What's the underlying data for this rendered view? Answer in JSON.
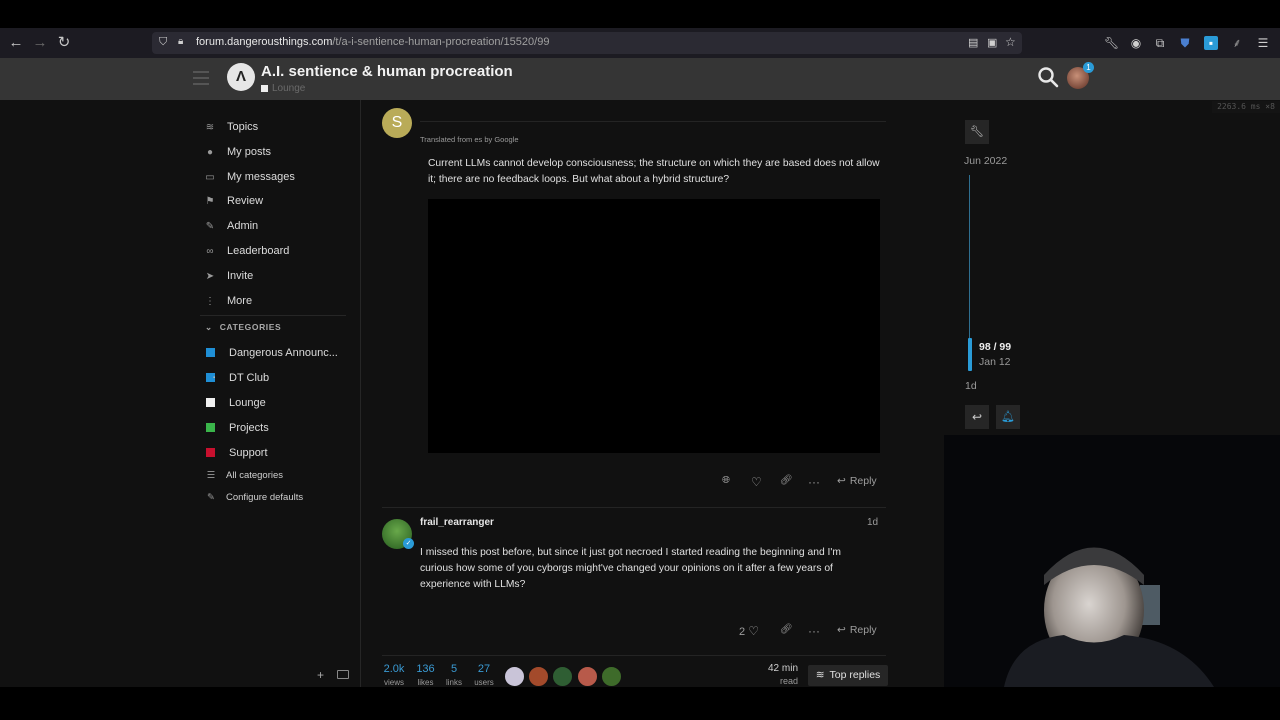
{
  "browser": {
    "url_host": "forum.dangerousthings.com",
    "url_path": "/t/a-i-sentience-human-procreation/15520/99"
  },
  "header": {
    "title": "A.I. sentience & human procreation",
    "category": "Lounge",
    "logo_text": "Λ",
    "notification_count": "1"
  },
  "perf": "2263.6 ms ×8",
  "sidebar": {
    "items": [
      {
        "label": "Topics",
        "icon": "layers-icon"
      },
      {
        "label": "My posts",
        "icon": "user-icon"
      },
      {
        "label": "My messages",
        "icon": "inbox-icon"
      },
      {
        "label": "Review",
        "icon": "flag-icon"
      },
      {
        "label": "Admin",
        "icon": "wrench-icon"
      },
      {
        "label": "Leaderboard",
        "icon": "link-icon"
      },
      {
        "label": "Invite",
        "icon": "paper-plane-icon"
      },
      {
        "label": "More",
        "icon": "more-vertical-icon"
      }
    ],
    "categories_heading": "CATEGORIES",
    "categories": [
      {
        "label": "Dangerous Announc...",
        "color": "#1f8fd6"
      },
      {
        "label": "DT Club",
        "color": "#1f8fd6"
      },
      {
        "label": "Lounge",
        "color": "#f0f0f0"
      },
      {
        "label": "Projects",
        "color": "#3ab54a"
      },
      {
        "label": "Support",
        "color": "#c8102e"
      }
    ],
    "all_categories": "All categories",
    "configure_defaults": "Configure defaults"
  },
  "post98": {
    "avatar_letter": "S",
    "translated_note": "Translated from es by Google",
    "text": "Current LLMs cannot develop consciousness; the structure on which they are based does not allow it; there are no feedback loops. But what about a hybrid structure?",
    "reply_label": "Reply"
  },
  "post99": {
    "username": "frail_rearranger",
    "age": "1d",
    "text": "I missed this post before, but since it just got necroed I started reading the beginning and I'm curious how some of you cyborgs might've changed your opinions on it after a few years of experience with LLMs?",
    "like_count": "2",
    "reply_label": "Reply"
  },
  "topic_stats": {
    "views": {
      "num": "2.0k",
      "label": "views"
    },
    "likes": {
      "num": "136",
      "label": "likes"
    },
    "links": {
      "num": "5",
      "label": "links"
    },
    "users": {
      "num": "27",
      "label": "users"
    },
    "read_time": "42 min",
    "read_label": "read",
    "top_replies": "Top replies"
  },
  "timeline": {
    "start": "Jun 2022",
    "position": "98 / 99",
    "position_date": "Jan 12",
    "end": "1d"
  }
}
